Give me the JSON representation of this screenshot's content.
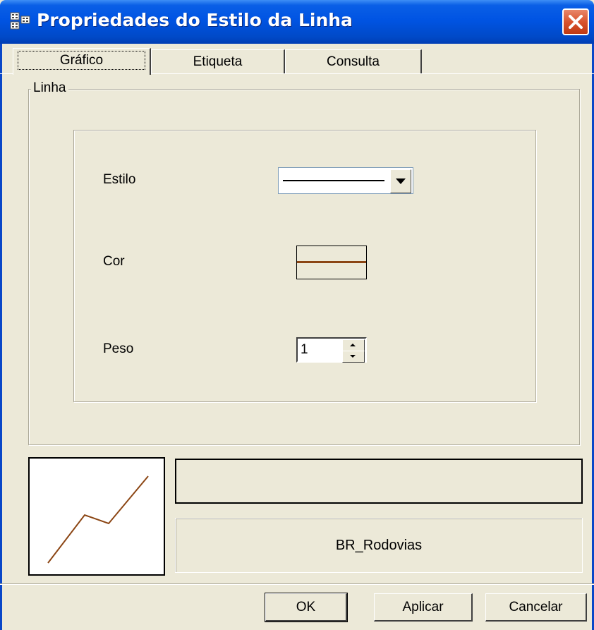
{
  "window": {
    "title": "Propriedades do Estilo da Linha"
  },
  "tabs": [
    {
      "label": "Gráfico",
      "active": true
    },
    {
      "label": "Etiqueta",
      "active": false
    },
    {
      "label": "Consulta",
      "active": false
    }
  ],
  "group": {
    "legend": "Linha",
    "fields": {
      "estilo": {
        "label": "Estilo",
        "value": "solid"
      },
      "cor": {
        "label": "Cor",
        "color": "#8b4513"
      },
      "peso": {
        "label": "Peso",
        "value": "1"
      }
    }
  },
  "preview": {
    "line_color": "#8b4513"
  },
  "layer_name": "BR_Rodovias",
  "buttons": {
    "ok": "OK",
    "apply": "Aplicar",
    "cancel": "Cancelar"
  }
}
